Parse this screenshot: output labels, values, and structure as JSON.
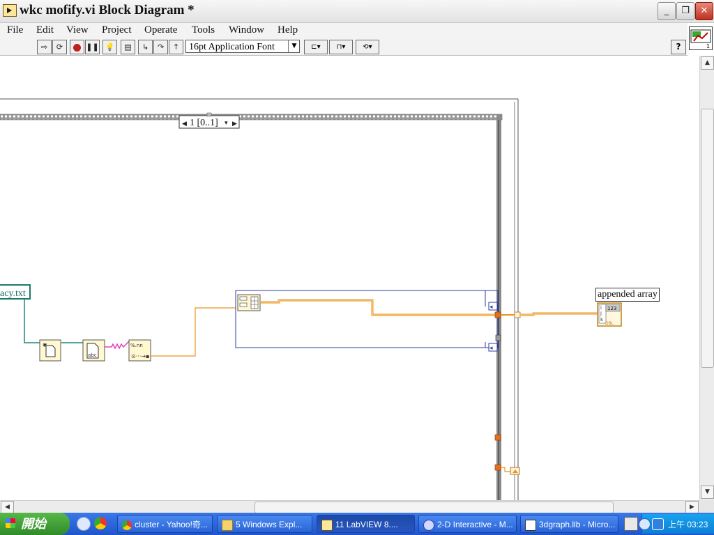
{
  "window": {
    "title": "wkc mofify.vi Block Diagram *"
  },
  "menu": {
    "items": [
      {
        "label": "File"
      },
      {
        "label": "Edit"
      },
      {
        "label": "View"
      },
      {
        "label": "Project"
      },
      {
        "label": "Operate"
      },
      {
        "label": "Tools"
      },
      {
        "label": "Window"
      },
      {
        "label": "Help"
      }
    ]
  },
  "toolbar": {
    "font_select": "16pt Application Font"
  },
  "diagram": {
    "case_selector": "1 [0..1]",
    "path_constant": "acy.txt",
    "indicator_label": "appended array",
    "indicator_type": "DBL",
    "indicator_digits": "123"
  },
  "taskbar": {
    "start_label": "開始",
    "tasks": [
      {
        "label": "cluster - Yahoo!奇...",
        "icon": "chrome-icon"
      },
      {
        "label": "5 Windows Expl...",
        "icon": "folder-icon"
      },
      {
        "label": "11 LabVIEW 8....",
        "icon": "labview-icon"
      },
      {
        "label": "2-D Interactive - M...",
        "icon": "app-icon"
      },
      {
        "label": "3dgraph.llb - Micro...",
        "icon": "document-icon"
      }
    ],
    "clock": "上午 03:23"
  }
}
